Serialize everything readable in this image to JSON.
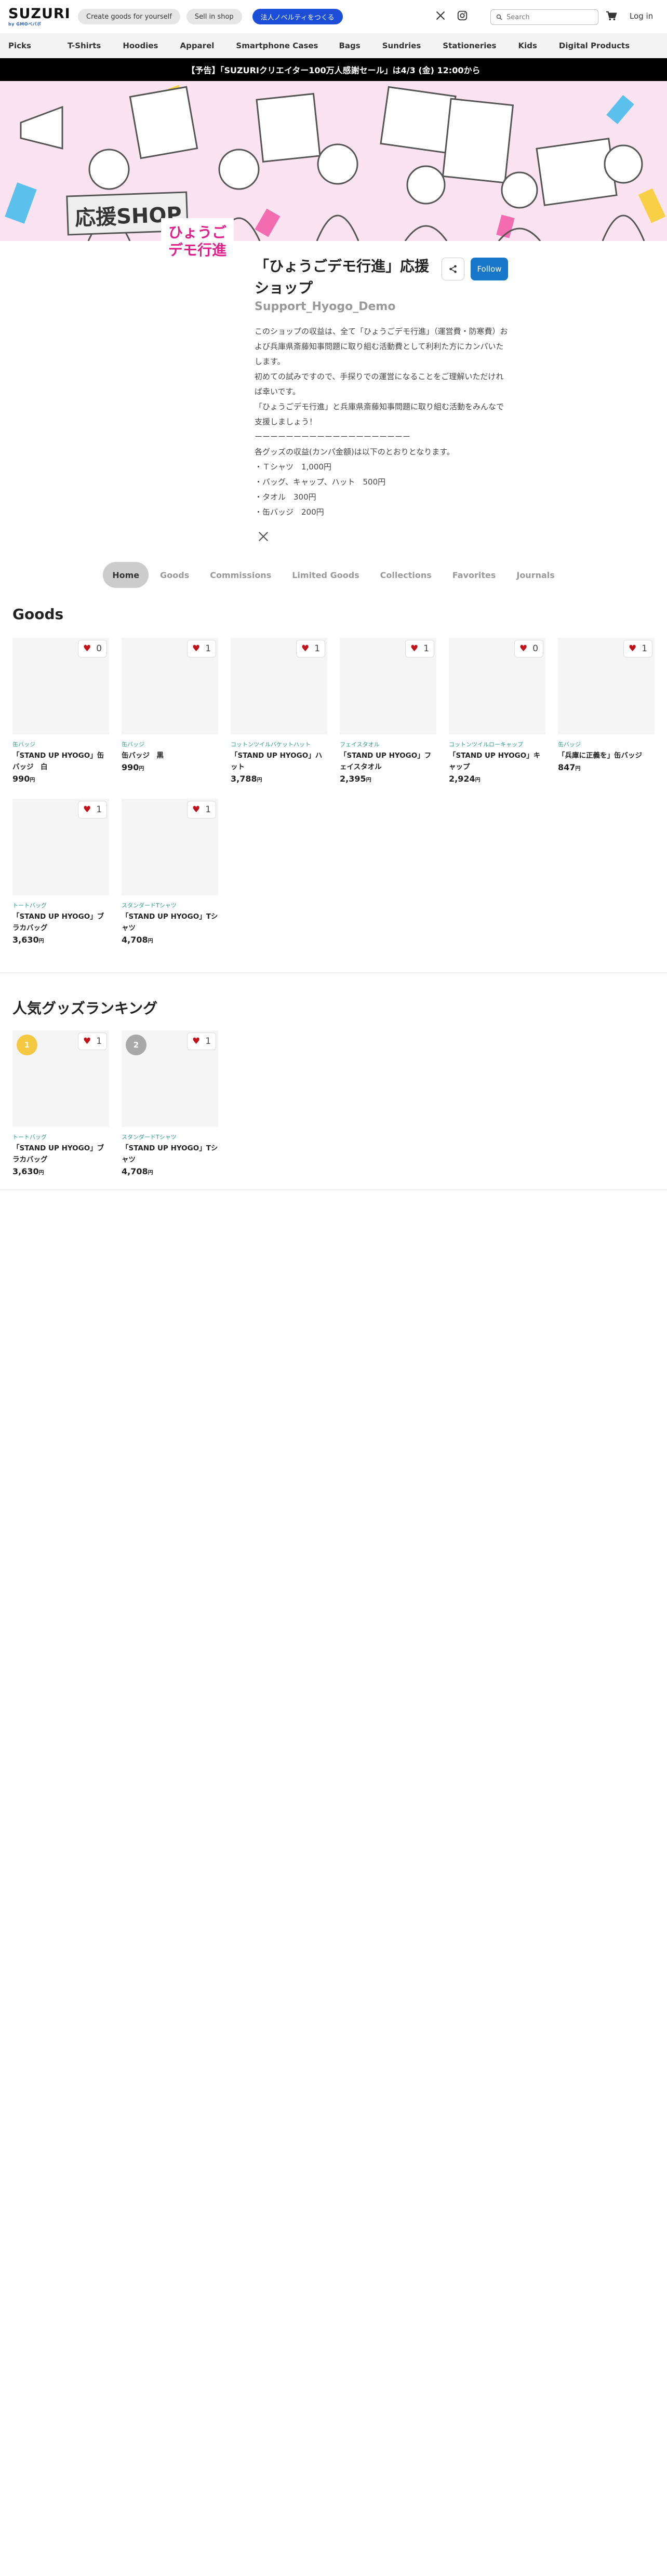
{
  "header": {
    "logo": "SUZURI",
    "logo_sub": "by GMOペパボ",
    "create_goods": "Create goods for yourself",
    "sell_in_shop": "Sell in shop",
    "corporate": "法人ノベルティをつくる",
    "search_placeholder": "Search",
    "login": "Log in"
  },
  "categories": [
    "Picks",
    "T-Shirts",
    "Hoodies",
    "Apparel",
    "Smartphone Cases",
    "Bags",
    "Sundries",
    "Stationeries",
    "Kids",
    "Digital Products"
  ],
  "announcement": "【予告】「SUZURIクリエイター100万人感謝セール」は4/3 (金) 12:00から",
  "banner": {
    "shop_label": "応援SHOP",
    "logo_text_1": "ひょうご",
    "logo_text_2": "デモ行進"
  },
  "shop": {
    "title": "「ひょうごデモ行進」応援ショップ",
    "id": "Support_Hyogo_Demo",
    "follow": "Follow",
    "description": [
      "このショップの収益は、全て「ひょうごデモ行進」（運営費・防寒費）および兵庫県斎藤知事問題に取り組む活動費として利利た方にカンパいたします。",
      "初めての試みですので、手探りでの運営になることをご理解いただければ幸いです。",
      "「ひょうごデモ行進」と兵庫県斎藤知事問題に取り組む活動をみんなで支援しましょう！",
      "ーーーーーーーーーーーーーーーーーーーー",
      "各グッズの収益(カンパ金額)は以下のとおりとなります。",
      "・Ｔシャツ　1,000円",
      "・バッグ、キャップ、ハット　500円",
      "・タオル　300円",
      "・缶バッジ　200円"
    ]
  },
  "tabs": [
    "Home",
    "Goods",
    "Commissions",
    "Limited Goods",
    "Collections",
    "Favorites",
    "Journals"
  ],
  "goods_section": {
    "title": "Goods",
    "items": [
      {
        "category": "缶バッジ",
        "name": "「STAND UP HYOGO」缶バッジ　白",
        "price": "990",
        "likes": "0"
      },
      {
        "category": "缶バッジ",
        "name": "缶バッジ　黒",
        "price": "990",
        "likes": "1"
      },
      {
        "category": "コットンツイルバケットハット",
        "name": "「STAND UP HYOGO」ハット",
        "price": "3,788",
        "likes": "1"
      },
      {
        "category": "フェイスタオル",
        "name": "「STAND UP HYOGO」フェイスタオル",
        "price": "2,395",
        "likes": "1"
      },
      {
        "category": "コットンツイルローキャップ",
        "name": "「STAND UP HYOGO」キャップ",
        "price": "2,924",
        "likes": "0"
      },
      {
        "category": "缶バッジ",
        "name": "「兵庫に正義を」缶バッジ",
        "price": "847",
        "likes": "1"
      },
      {
        "category": "トートバッグ",
        "name": "「STAND UP HYOGO」ブラカバッグ",
        "price": "3,630",
        "likes": "1"
      },
      {
        "category": "スタンダードTシャツ",
        "name": "「STAND UP HYOGO」Tシャツ",
        "price": "4,708",
        "likes": "1"
      }
    ]
  },
  "ranking_section": {
    "title": "人気グッズランキング",
    "items": [
      {
        "rank": "1",
        "category": "トートバッグ",
        "name": "「STAND UP HYOGO」ブラカバッグ",
        "price": "3,630",
        "likes": "1",
        "badge_color": "#f5c842"
      },
      {
        "rank": "2",
        "category": "スタンダードTシャツ",
        "name": "「STAND UP HYOGO」Tシャツ",
        "price": "4,708",
        "likes": "1",
        "badge_color": "#a8a8a8"
      }
    ]
  },
  "currency": "円",
  "colors": {
    "accent": "#1877c9",
    "black_bar": "#000000",
    "category_text": "#2a9d8f"
  }
}
